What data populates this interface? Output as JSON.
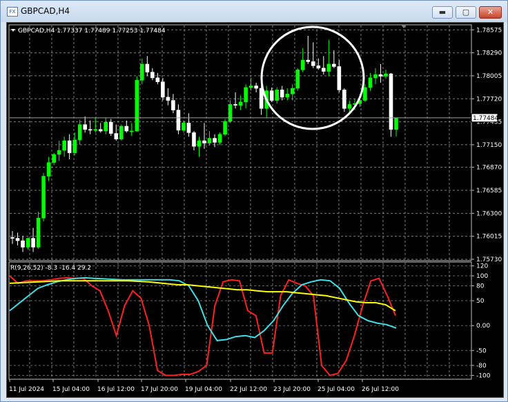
{
  "window": {
    "title": "GBPCAD,H4",
    "icon_label": "FX",
    "buttons": {
      "minimize": "▬",
      "maximize": "▢",
      "close": "✕"
    }
  },
  "chart": {
    "header": "GBPCAD,H4  1.77337 1.77489 1.77253 1.77484",
    "price_labels": [
      "1.78575",
      "1.78290",
      "1.78005",
      "1.77720",
      "1.77435",
      "1.77150",
      "1.76870",
      "1.76585",
      "1.76300",
      "1.76015",
      "1.75730"
    ],
    "current_price": "1.77484",
    "indicator_header": "R(9,26,52) -8.3 -16.4 29.2",
    "indicator_labels": [
      "120",
      "100",
      "80",
      "50",
      "0.00",
      "-50",
      "-80",
      "-100"
    ],
    "time_labels": [
      "11 Jul 2024",
      "15 Jul 04:00",
      "16 Jul 12:00",
      "17 Jul 20:00",
      "19 Jul 04:00",
      "22 Jul 12:00",
      "23 Jul 20:00",
      "25 Jul 04:00",
      "26 Jul 12:00"
    ],
    "colors": {
      "background": "#000000",
      "bull_candle": "#00ff00",
      "bear_candle": "#ffffff",
      "grid": "#b0b0b0",
      "red_line": "#ff2020",
      "cyan_line": "#40e0e8",
      "yellow_line": "#ffff00",
      "highlight_circle": "#ffffff"
    }
  },
  "chart_data": {
    "type": "candlestick",
    "title": "GBPCAD,H4",
    "ylim": [
      1.7573,
      1.7862
    ],
    "candles": [
      [
        1.76,
        1.7608,
        1.7592,
        1.7599
      ],
      [
        1.7599,
        1.7606,
        1.759,
        1.7596
      ],
      [
        1.7596,
        1.7602,
        1.7582,
        1.7588
      ],
      [
        1.7588,
        1.76,
        1.7585,
        1.7599
      ],
      [
        1.7599,
        1.7612,
        1.7582,
        1.7588
      ],
      [
        1.7588,
        1.7632,
        1.7586,
        1.7624
      ],
      [
        1.7624,
        1.768,
        1.762,
        1.7676
      ],
      [
        1.7676,
        1.77,
        1.767,
        1.7693
      ],
      [
        1.7693,
        1.7705,
        1.769,
        1.7703
      ],
      [
        1.7703,
        1.772,
        1.7695,
        1.7708
      ],
      [
        1.7708,
        1.7725,
        1.77,
        1.772
      ],
      [
        1.772,
        1.7728,
        1.7697,
        1.7705
      ],
      [
        1.7705,
        1.773,
        1.7702,
        1.7721
      ],
      [
        1.7721,
        1.7746,
        1.7715,
        1.774
      ],
      [
        1.774,
        1.775,
        1.773,
        1.7734
      ],
      [
        1.7734,
        1.7745,
        1.7728,
        1.7733
      ],
      [
        1.7733,
        1.7748,
        1.773,
        1.7734
      ],
      [
        1.7734,
        1.7742,
        1.773,
        1.7732
      ],
      [
        1.7732,
        1.7748,
        1.7728,
        1.7743
      ],
      [
        1.7743,
        1.7747,
        1.7726,
        1.7729
      ],
      [
        1.7729,
        1.774,
        1.772,
        1.7722
      ],
      [
        1.7722,
        1.774,
        1.772,
        1.7738
      ],
      [
        1.7738,
        1.7745,
        1.773,
        1.7732
      ],
      [
        1.7732,
        1.7742,
        1.7726,
        1.7732
      ],
      [
        1.7732,
        1.78,
        1.7731,
        1.7795
      ],
      [
        1.7795,
        1.7822,
        1.779,
        1.7815
      ],
      [
        1.7815,
        1.7825,
        1.78,
        1.7805
      ],
      [
        1.7805,
        1.781,
        1.7795,
        1.7798
      ],
      [
        1.7798,
        1.7804,
        1.779,
        1.7793
      ],
      [
        1.7793,
        1.7798,
        1.777,
        1.7774
      ],
      [
        1.7774,
        1.7785,
        1.7764,
        1.777
      ],
      [
        1.777,
        1.7778,
        1.7754,
        1.7758
      ],
      [
        1.7758,
        1.7765,
        1.7728,
        1.7733
      ],
      [
        1.7733,
        1.7745,
        1.773,
        1.7742
      ],
      [
        1.7742,
        1.7754,
        1.7725,
        1.773
      ],
      [
        1.773,
        1.7732,
        1.7708,
        1.7713
      ],
      [
        1.7713,
        1.7725,
        1.77,
        1.772
      ],
      [
        1.772,
        1.7742,
        1.771,
        1.7717
      ],
      [
        1.7717,
        1.7732,
        1.7714,
        1.7723
      ],
      [
        1.7723,
        1.7728,
        1.7712,
        1.7718
      ],
      [
        1.7718,
        1.773,
        1.7715,
        1.7728
      ],
      [
        1.7728,
        1.7747,
        1.7726,
        1.7744
      ],
      [
        1.7744,
        1.777,
        1.7742,
        1.7765
      ],
      [
        1.7765,
        1.778,
        1.776,
        1.7764
      ],
      [
        1.7764,
        1.7776,
        1.7758,
        1.7768
      ],
      [
        1.7768,
        1.779,
        1.776,
        1.7786
      ],
      [
        1.7786,
        1.7798,
        1.7782,
        1.7788
      ],
      [
        1.7788,
        1.7792,
        1.778,
        1.7785
      ],
      [
        1.7785,
        1.779,
        1.7752,
        1.776
      ],
      [
        1.776,
        1.7788,
        1.7748,
        1.7782
      ],
      [
        1.7782,
        1.7786,
        1.7768,
        1.777
      ],
      [
        1.777,
        1.7786,
        1.7766,
        1.7783
      ],
      [
        1.7783,
        1.7788,
        1.777,
        1.7774
      ],
      [
        1.7774,
        1.7785,
        1.777,
        1.7778
      ],
      [
        1.7778,
        1.779,
        1.777,
        1.7785
      ],
      [
        1.7785,
        1.781,
        1.7782,
        1.7808
      ],
      [
        1.7808,
        1.7835,
        1.7805,
        1.782
      ],
      [
        1.782,
        1.785,
        1.7815,
        1.7818
      ],
      [
        1.7818,
        1.7842,
        1.781,
        1.7813
      ],
      [
        1.7813,
        1.7822,
        1.7808,
        1.781
      ],
      [
        1.781,
        1.7825,
        1.7802,
        1.7806
      ],
      [
        1.7806,
        1.7845,
        1.78,
        1.7815
      ],
      [
        1.7815,
        1.7832,
        1.781,
        1.7812
      ],
      [
        1.7812,
        1.782,
        1.778,
        1.7783
      ],
      [
        1.7783,
        1.7785,
        1.7756,
        1.776
      ],
      [
        1.776,
        1.777,
        1.7756,
        1.7765
      ],
      [
        1.7765,
        1.7772,
        1.7758,
        1.7766
      ],
      [
        1.7766,
        1.7778,
        1.7762,
        1.777
      ],
      [
        1.777,
        1.779,
        1.7768,
        1.7786
      ],
      [
        1.7786,
        1.7804,
        1.7782,
        1.7798
      ],
      [
        1.7798,
        1.781,
        1.779,
        1.7802
      ],
      [
        1.7802,
        1.7815,
        1.7792,
        1.78
      ],
      [
        1.78,
        1.7808,
        1.7797,
        1.7803
      ],
      [
        1.7803,
        1.7804,
        1.7725,
        1.7734
      ],
      [
        1.7734,
        1.77489,
        1.77253,
        1.77484
      ]
    ],
    "indicator": {
      "name": "R(9,26,52)",
      "values": [
        -8.3,
        -16.4,
        29.2
      ],
      "ylim": [
        -105,
        125
      ],
      "series": [
        {
          "color": "red",
          "values": [
            100,
            85,
            90,
            90,
            90,
            92,
            95,
            96,
            95,
            95,
            80,
            70,
            30,
            -20,
            40,
            70,
            55,
            0,
            -90,
            -100,
            -100,
            -98,
            -98,
            -92,
            -80,
            40,
            88,
            92,
            90,
            30,
            20,
            -55,
            -55,
            60,
            92,
            85,
            80,
            60,
            -80,
            -100,
            -96,
            -70,
            -20,
            40,
            90,
            95,
            60,
            20
          ]
        },
        {
          "color": "cyan",
          "values": [
            30,
            45,
            60,
            75,
            82,
            88,
            92,
            95,
            96,
            95,
            94,
            93,
            92,
            92,
            92,
            92,
            92,
            92,
            90,
            80,
            50,
            0,
            -30,
            -28,
            -22,
            -20,
            -24,
            -10,
            10,
            40,
            65,
            82,
            88,
            92,
            90,
            75,
            45,
            20,
            10,
            5,
            2,
            -5
          ]
        },
        {
          "color": "yellow",
          "values": [
            85,
            86,
            87,
            88,
            89,
            90,
            90,
            90,
            90,
            90,
            90,
            90,
            90,
            89,
            88,
            86,
            84,
            82,
            82,
            80,
            78,
            76,
            74,
            72,
            72,
            70,
            68,
            68,
            68,
            66,
            64,
            62,
            60,
            56,
            52,
            48,
            46,
            46,
            42,
            30
          ]
        }
      ]
    }
  }
}
